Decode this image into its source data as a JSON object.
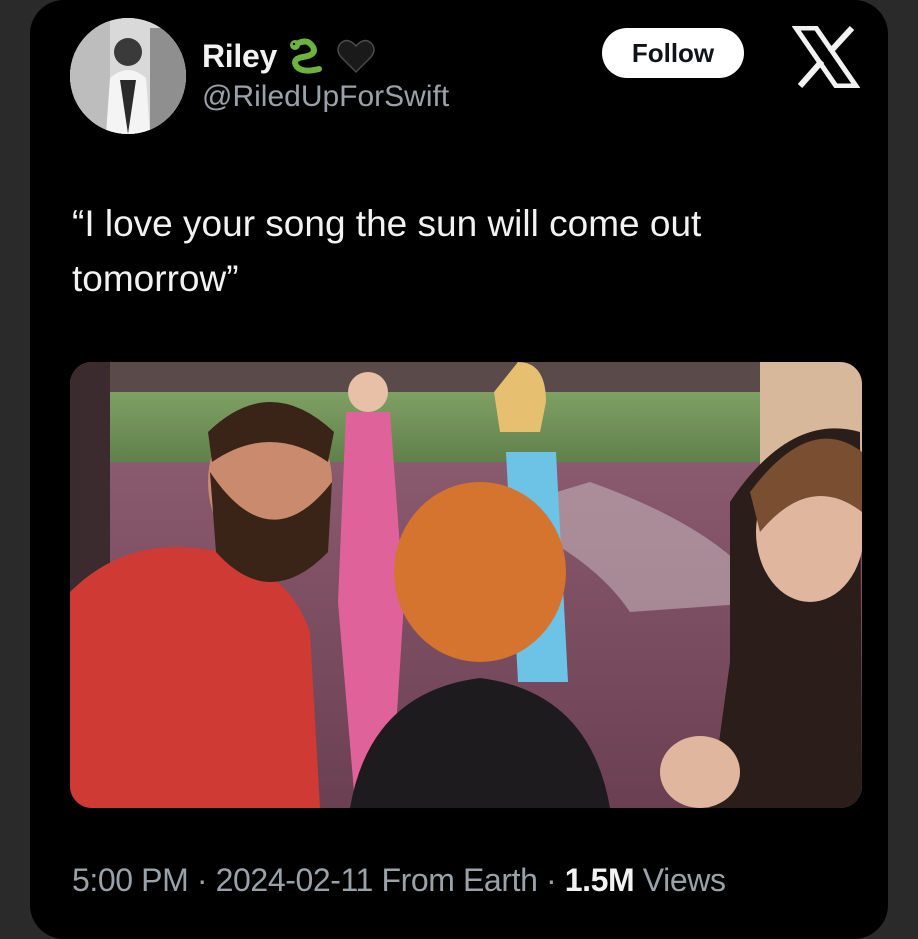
{
  "user": {
    "display_name": "Riley",
    "name_emojis": [
      "snake-emoji",
      "black-heart-emoji"
    ],
    "handle": "@RiledUpForSwift"
  },
  "follow_label": "Follow",
  "tweet": {
    "line1": "“I love your song the sun will come out",
    "line2": "tomorrow”"
  },
  "meta": {
    "time": "5:00 PM",
    "sep1": " · ",
    "date": "2024-02-11",
    "source": " From Earth",
    "sep2": " · ",
    "views_count": "1.5M",
    "views_label": " Views"
  },
  "colors": {
    "background": "#000000",
    "text_primary": "#f2f2f2",
    "text_secondary": "#9aa1a8",
    "follow_bg": "#ffffff"
  }
}
